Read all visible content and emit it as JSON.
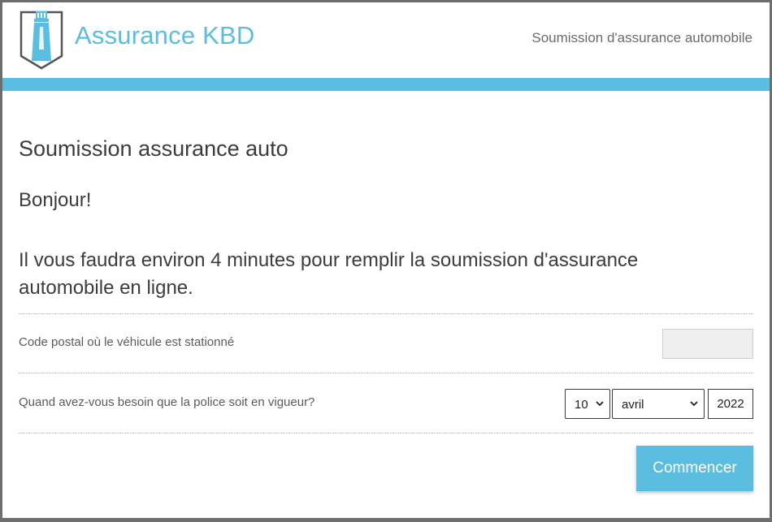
{
  "header": {
    "brand": "Assurance KBD",
    "title": "Soumission d'assurance automobile",
    "logo_icon": "lighthouse-shield-icon",
    "accent_color": "#5bbde0"
  },
  "main": {
    "page_title": "Soumission assurance auto",
    "greeting": "Bonjour!",
    "intro": "Il vous faudra environ 4 minutes pour remplir la soumission d'assurance automobile en ligne.",
    "postal": {
      "label": "Code postal où le véhicule est stationné",
      "value": ""
    },
    "start_date": {
      "label": "Quand avez-vous besoin que la police soit en vigueur?",
      "day": "10",
      "month": "avril",
      "year": "2022"
    },
    "start_button": "Commencer"
  }
}
